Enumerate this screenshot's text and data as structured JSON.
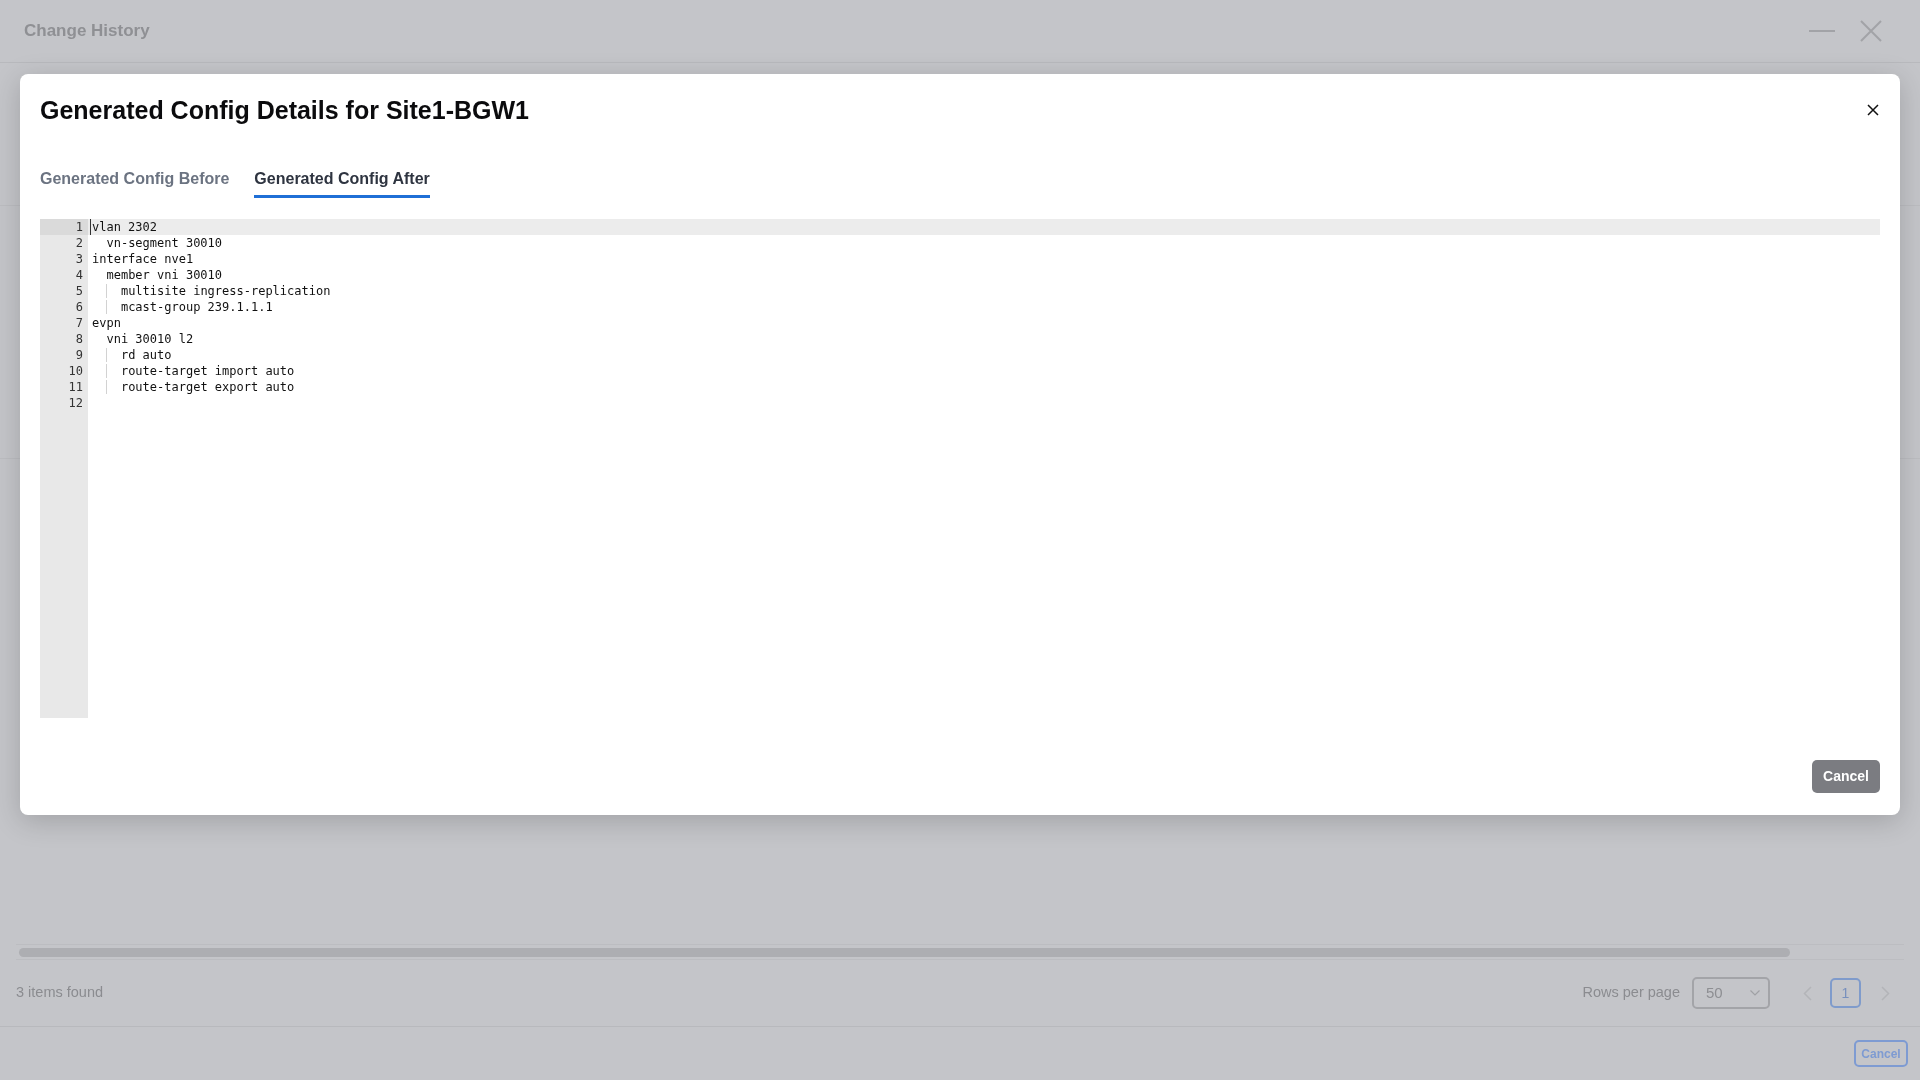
{
  "window": {
    "title": "Change History"
  },
  "dialog": {
    "title": "Generated Config Details for Site1-BGW1",
    "tabs": [
      {
        "label": "Generated Config Before",
        "selected": false
      },
      {
        "label": "Generated Config After",
        "selected": true
      }
    ],
    "editor": {
      "lines": [
        {
          "number": "1",
          "text": "vlan 2302",
          "active": true
        },
        {
          "number": "2",
          "text": "  vn-segment 30010",
          "active": false
        },
        {
          "number": "3",
          "text": "interface nve1",
          "active": false
        },
        {
          "number": "4",
          "text": "  member vni 30010",
          "active": false
        },
        {
          "number": "5",
          "text": "    multisite ingress-replication",
          "active": false
        },
        {
          "number": "6",
          "text": "    mcast-group 239.1.1.1",
          "active": false
        },
        {
          "number": "7",
          "text": "evpn",
          "active": false
        },
        {
          "number": "8",
          "text": "  vni 30010 l2",
          "active": false
        },
        {
          "number": "9",
          "text": "    rd auto",
          "active": false
        },
        {
          "number": "10",
          "text": "    route-target import auto",
          "active": false
        },
        {
          "number": "11",
          "text": "    route-target export auto",
          "active": false
        },
        {
          "number": "12",
          "active": false
        }
      ]
    },
    "cancel_button": "Cancel"
  },
  "pagination": {
    "summary": "3 items found",
    "rows_per_page_label": "Rows per page",
    "rows_per_page": "50",
    "pages": [
      {
        "label": "1",
        "selected": true
      }
    ]
  },
  "footer": {
    "cancel_button": "Cancel"
  }
}
